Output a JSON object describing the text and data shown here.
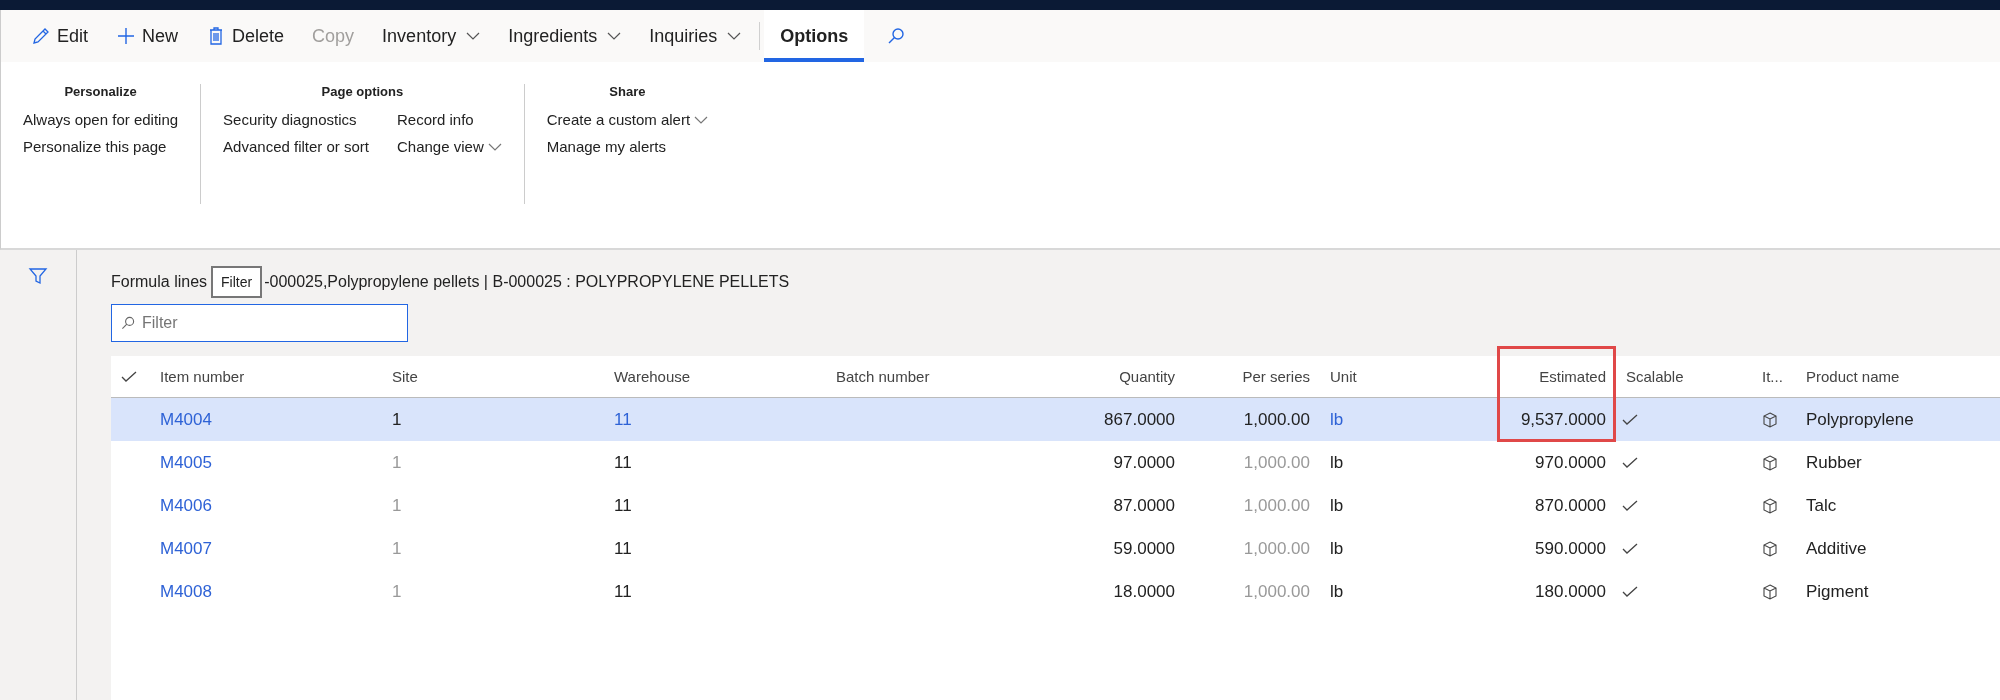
{
  "toolbar": {
    "items": [
      {
        "label": "Edit",
        "disabled": false,
        "dropdown": false,
        "selected": false
      },
      {
        "label": "New",
        "disabled": false,
        "dropdown": false,
        "selected": false
      },
      {
        "label": "Delete",
        "disabled": false,
        "dropdown": false,
        "selected": false
      },
      {
        "label": "Copy",
        "disabled": true,
        "dropdown": false,
        "selected": false
      },
      {
        "label": "Inventory",
        "disabled": false,
        "dropdown": true,
        "selected": false
      },
      {
        "label": "Ingredients",
        "disabled": false,
        "dropdown": true,
        "selected": false
      },
      {
        "label": "Inquiries",
        "disabled": false,
        "dropdown": true,
        "selected": false
      },
      {
        "label": "Options",
        "disabled": false,
        "dropdown": false,
        "selected": true
      }
    ]
  },
  "ribbon": {
    "groups": [
      {
        "title": "Personalize",
        "columns": [
          [
            {
              "label": "Always open for editing",
              "dropdown": false
            },
            {
              "label": "Personalize this page",
              "dropdown": false
            }
          ]
        ]
      },
      {
        "title": "Page options",
        "columns": [
          [
            {
              "label": "Security diagnostics",
              "dropdown": false
            },
            {
              "label": "Advanced filter or sort",
              "dropdown": false
            }
          ],
          [
            {
              "label": "Record info",
              "dropdown": false
            },
            {
              "label": "Change view",
              "dropdown": true
            }
          ]
        ]
      },
      {
        "title": "Share",
        "columns": [
          [
            {
              "label": "Create a custom alert",
              "dropdown": true
            },
            {
              "label": "Manage my alerts",
              "dropdown": false
            }
          ]
        ]
      }
    ]
  },
  "header": {
    "title": "Formula lines",
    "tooltip": "Filter",
    "subtitle": "-000025,Polypropylene pellets | B-000025 : POLYPROPYLENE PELLETS"
  },
  "filter": {
    "placeholder": "Filter"
  },
  "grid": {
    "columns": [
      {
        "label": "Item number",
        "highlighted": false
      },
      {
        "label": "Site",
        "highlighted": false
      },
      {
        "label": "Warehouse",
        "highlighted": false
      },
      {
        "label": "Batch number",
        "highlighted": false
      },
      {
        "label": "Quantity",
        "highlighted": false
      },
      {
        "label": "Per series",
        "highlighted": false
      },
      {
        "label": "Unit",
        "highlighted": false
      },
      {
        "label": "Estimated",
        "highlighted": true
      },
      {
        "label": "Scalable",
        "highlighted": false
      },
      {
        "label": "It...",
        "highlighted": false
      },
      {
        "label": "Product name",
        "highlighted": false
      }
    ],
    "rows": [
      {
        "selected": true,
        "item_number": "M4004",
        "site": "1",
        "warehouse": "11",
        "quantity": "867.0000",
        "per_series": "1,000.00",
        "unit": "lb",
        "estimated": "9,537.0000",
        "scalable": true,
        "product_name": "Polypropylene"
      },
      {
        "selected": false,
        "item_number": "M4005",
        "site": "1",
        "warehouse": "11",
        "quantity": "97.0000",
        "per_series": "1,000.00",
        "unit": "lb",
        "estimated": "970.0000",
        "scalable": true,
        "product_name": "Rubber"
      },
      {
        "selected": false,
        "item_number": "M4006",
        "site": "1",
        "warehouse": "11",
        "quantity": "87.0000",
        "per_series": "1,000.00",
        "unit": "lb",
        "estimated": "870.0000",
        "scalable": true,
        "product_name": "Talc"
      },
      {
        "selected": false,
        "item_number": "M4007",
        "site": "1",
        "warehouse": "11",
        "quantity": "59.0000",
        "per_series": "1,000.00",
        "unit": "lb",
        "estimated": "590.0000",
        "scalable": true,
        "product_name": "Additive"
      },
      {
        "selected": false,
        "item_number": "M4008",
        "site": "1",
        "warehouse": "11",
        "quantity": "18.0000",
        "per_series": "1,000.00",
        "unit": "lb",
        "estimated": "180.0000",
        "scalable": true,
        "product_name": "Pigment"
      }
    ]
  }
}
